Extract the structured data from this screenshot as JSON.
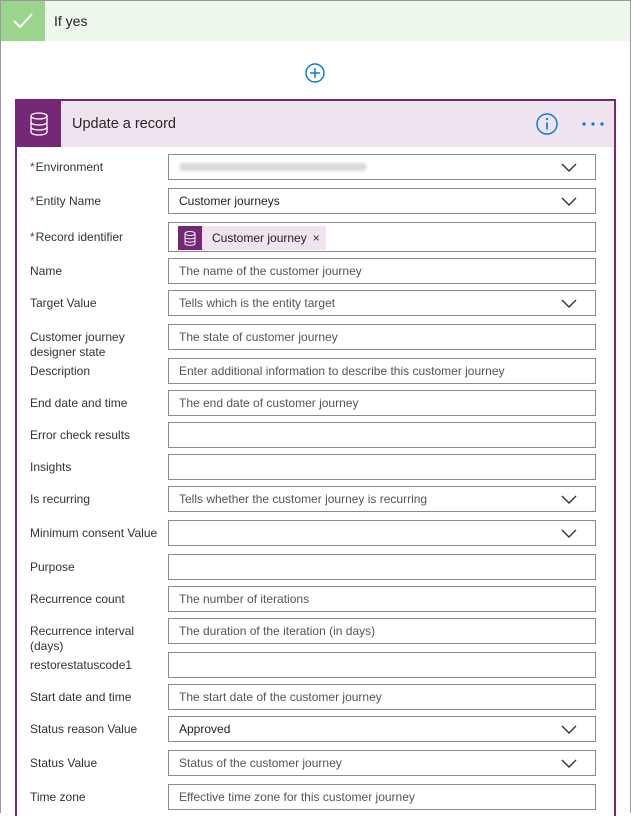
{
  "condition": {
    "title": "If yes"
  },
  "action": {
    "title": "Update a record",
    "fields": [
      {
        "label": "Environment",
        "required": true,
        "type": "dropdown",
        "value": "",
        "placeholder": "",
        "blurred": true
      },
      {
        "label": "Entity Name",
        "required": true,
        "type": "dropdown",
        "value": "Customer journeys",
        "placeholder": ""
      },
      {
        "label": "Record identifier",
        "required": true,
        "type": "token",
        "token": "Customer journey"
      },
      {
        "label": "Name",
        "required": false,
        "type": "text",
        "value": "",
        "placeholder": "The name of the customer journey"
      },
      {
        "label": "Target Value",
        "required": false,
        "type": "dropdown",
        "value": "",
        "placeholder": "Tells which is the entity target"
      },
      {
        "label": "Customer journey designer state",
        "required": false,
        "type": "text",
        "value": "",
        "placeholder": "The state of customer journey"
      },
      {
        "label": "Description",
        "required": false,
        "type": "text",
        "value": "",
        "placeholder": "Enter additional information to describe this customer journey"
      },
      {
        "label": "End date and time",
        "required": false,
        "type": "text",
        "value": "",
        "placeholder": "The end date of customer journey"
      },
      {
        "label": "Error check results",
        "required": false,
        "type": "text",
        "value": "",
        "placeholder": ""
      },
      {
        "label": "Insights",
        "required": false,
        "type": "text",
        "value": "",
        "placeholder": ""
      },
      {
        "label": "Is recurring",
        "required": false,
        "type": "dropdown",
        "value": "",
        "placeholder": "Tells whether the customer journey is recurring"
      },
      {
        "label": "Minimum consent Value",
        "required": false,
        "type": "dropdown",
        "value": "",
        "placeholder": ""
      },
      {
        "label": "Purpose",
        "required": false,
        "type": "text",
        "value": "",
        "placeholder": ""
      },
      {
        "label": "Recurrence count",
        "required": false,
        "type": "text",
        "value": "",
        "placeholder": "The number of iterations"
      },
      {
        "label": "Recurrence interval (days)",
        "required": false,
        "type": "text",
        "value": "",
        "placeholder": "The duration of the iteration (in days)"
      },
      {
        "label": "restorestatuscode1",
        "required": false,
        "type": "text",
        "value": "",
        "placeholder": ""
      },
      {
        "label": "Start date and time",
        "required": false,
        "type": "text",
        "value": "",
        "placeholder": "The start date of the customer journey"
      },
      {
        "label": "Status reason Value",
        "required": false,
        "type": "dropdown",
        "value": "Approved",
        "placeholder": ""
      },
      {
        "label": "Status Value",
        "required": false,
        "type": "dropdown",
        "value": "",
        "placeholder": "Status of the customer journey"
      },
      {
        "label": "Time zone",
        "required": false,
        "type": "text",
        "value": "",
        "placeholder": "Effective time zone for this customer journey"
      }
    ]
  },
  "icons": {
    "check": "checkmark-icon",
    "add": "add-circle-icon",
    "database": "database-icon",
    "info": "info-icon",
    "more": "more-icon",
    "chevron": "chevron-down-icon",
    "close": "close-icon"
  },
  "colors": {
    "accent": "#742774",
    "accent_light": "#efe3ef",
    "success": "#9bd58d",
    "success_light": "#eef7ec",
    "link_blue": "#0078d4",
    "required": "#a4262c"
  }
}
